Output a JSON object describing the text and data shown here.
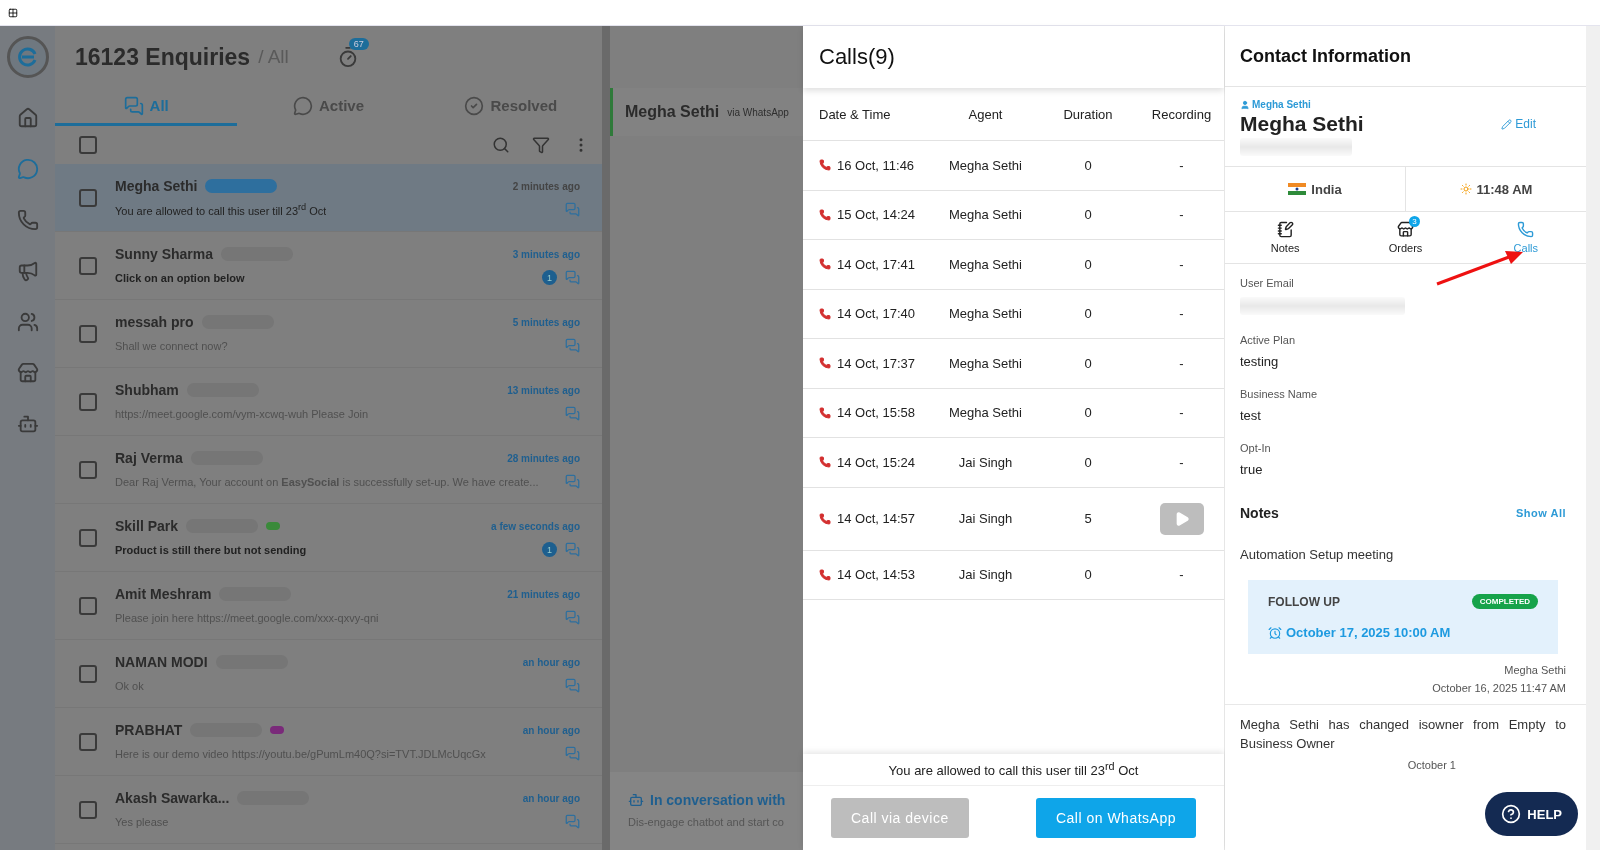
{
  "inbox": {
    "count_title": "16123 Enquiries",
    "filter": "/ All",
    "reminder_badge": "67",
    "tabs": [
      {
        "label": "All",
        "selected": true
      },
      {
        "label": "Active",
        "selected": false
      },
      {
        "label": "Resolved",
        "selected": false
      }
    ],
    "select_all_checked": false,
    "rows": [
      {
        "name": "Megha Sethi",
        "message": "You are allowed to call this user till 23$^{rd}$ Oct",
        "time": "2 minutes ago",
        "selected": true,
        "checked": false,
        "unread": "",
        "bold": false
      },
      {
        "name": "Sunny Sharma",
        "message": "Click on an option below",
        "time": "3 minutes ago",
        "selected": false,
        "checked": false,
        "unread": "1",
        "bold": true
      },
      {
        "name": "messah pro",
        "message": "Shall we connect now?",
        "time": "5 minutes ago",
        "selected": false,
        "checked": false,
        "bold": false
      },
      {
        "name": "Shubham",
        "message": "https://meet.google.com/vym-xcwq-wuh Please Join",
        "time": "13 minutes ago",
        "selected": false,
        "checked": false,
        "bold": false
      },
      {
        "name": "Raj Verma",
        "message": "Dear Raj Verma, Your account on **EasySocial** is successfully set-up. We have create...",
        "time": "28 minutes ago",
        "selected": false,
        "checked": false,
        "bold": false
      },
      {
        "name": "Skill Park",
        "message": "Product is still there but not sending",
        "time": "a few seconds ago",
        "selected": false,
        "checked": false,
        "unread": "1",
        "color": "#3a8a3a",
        "bold": true
      },
      {
        "name": "Amit Meshram",
        "message": "Please join here https://meet.google.com/xxx-qxvy-qni",
        "time": "21 minutes ago",
        "selected": false,
        "checked": false,
        "bold": false
      },
      {
        "name": "NAMAN MODI",
        "message": "Ok ok",
        "time": "an hour ago",
        "selected": false,
        "checked": false,
        "bold": false
      },
      {
        "name": "PRABHAT",
        "message": "Here is our demo video https://youtu.be/gPumLm40Q?si=TVT.JDLMcUqcGx",
        "time": "an hour ago",
        "selected": false,
        "checked": false,
        "color": "#7a2a7a",
        "bold": false
      },
      {
        "name": "Akash Sawarka...",
        "message": "Yes please",
        "time": "an hour ago",
        "selected": false,
        "checked": false,
        "bold": false
      }
    ]
  },
  "conversation": {
    "name": "Megha Sethi",
    "channel": "via WhatsApp",
    "banner_title": "In conversation with",
    "banner_text": "Dis-engage chatbot and start co"
  },
  "calls": {
    "title": "Calls(9)",
    "columns": [
      "Date & Time",
      "Agent",
      "Duration",
      "Recording"
    ],
    "rows": [
      {
        "time": "16 Oct, 11:46",
        "agent": "Megha Sethi",
        "duration": "0",
        "kind": "none",
        "recording": "-"
      },
      {
        "time": "15 Oct, 14:24",
        "agent": "Megha Sethi",
        "duration": "0",
        "kind": "none",
        "recording": "-"
      },
      {
        "time": "14 Oct, 17:41",
        "agent": "Megha Sethi",
        "duration": "0",
        "kind": "none",
        "recording": "-"
      },
      {
        "time": "14 Oct, 17:40",
        "agent": "Megha Sethi",
        "duration": "0",
        "kind": "none",
        "recording": "-"
      },
      {
        "time": "14 Oct, 17:37",
        "agent": "Megha Sethi",
        "duration": "0",
        "kind": "none",
        "recording": "-"
      },
      {
        "time": "14 Oct, 15:58",
        "agent": "Megha Sethi",
        "duration": "0",
        "kind": "none",
        "recording": "-"
      },
      {
        "time": "14 Oct, 15:24",
        "agent": "Jai Singh",
        "duration": "0",
        "kind": "none",
        "recording": "-"
      },
      {
        "time": "14 Oct, 14:57",
        "agent": "Jai Singh",
        "duration": "5",
        "kind": "play"
      },
      {
        "time": "14 Oct, 14:53",
        "agent": "Jai Singh",
        "duration": "0",
        "kind": "none",
        "recording": "-"
      }
    ],
    "notice": "You are allowed to call this user till 23$^{rd}$ Oct",
    "device_button": {
      "label": "Call via device",
      "disabled": true
    },
    "whatsapp_button": {
      "label": "Call on WhatsApp",
      "disabled": false
    }
  },
  "contact": {
    "title": "Contact Information",
    "owner": "Megha Sethi",
    "name": "Megha Sethi",
    "edit": "Edit",
    "country": "India",
    "local_time": "11:48 AM",
    "tabs": [
      {
        "label": "Notes",
        "selected": false
      },
      {
        "label": "Orders",
        "selected": false,
        "badge": "3"
      },
      {
        "label": "Calls",
        "selected": true
      }
    ],
    "fields": [
      {
        "label": "User Email",
        "kind": "redacted"
      },
      {
        "label": "Active Plan",
        "value": "testing",
        "kind": "text"
      },
      {
        "label": "Business Name",
        "value": "test",
        "kind": "text"
      },
      {
        "label": "Opt-In",
        "value": "true",
        "kind": "text"
      }
    ],
    "notes_title": "Notes",
    "show_all": "Show All",
    "notes": [
      {
        "text": "Automation Setup meeting",
        "followup": {
          "title": "FOLLOW UP",
          "status": "COMPLETED",
          "date": "October 17, 2025 10:00 AM"
        },
        "author": "Megha Sethi",
        "date": "October 16, 2025 11:47 AM"
      },
      {
        "text": "Megha Sethi has changed isowner from Empty to Business Owner",
        "date": "October 1"
      }
    ]
  },
  "help": "HELP"
}
